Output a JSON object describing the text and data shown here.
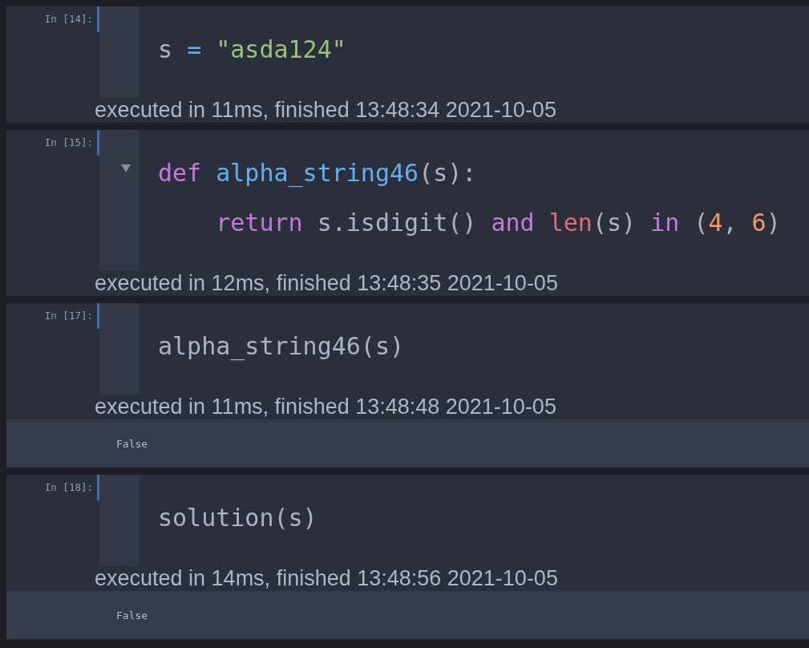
{
  "cells": [
    {
      "prompt": "In [14]:",
      "collapsible": false,
      "lines": [
        [
          {
            "kind": "name",
            "text": "s "
          },
          {
            "kind": "operator",
            "text": "="
          },
          {
            "kind": "string",
            "text": " \"asda124\""
          }
        ]
      ],
      "status": "executed in 11ms, finished 13:48:34 2021-10-05"
    },
    {
      "prompt": "In [15]:",
      "collapsible": true,
      "lines": [
        [
          {
            "kind": "keyword",
            "text": "def "
          },
          {
            "kind": "function",
            "text": "alpha_string46"
          },
          {
            "kind": "name",
            "text": "(s):"
          }
        ],
        [
          {
            "kind": "keyword",
            "text": "    return"
          },
          {
            "kind": "name",
            "text": " s.isdigit() "
          },
          {
            "kind": "keyword",
            "text": "and "
          },
          {
            "kind": "builtin",
            "text": "len"
          },
          {
            "kind": "name",
            "text": "(s) "
          },
          {
            "kind": "keyword",
            "text": "in"
          },
          {
            "kind": "name",
            "text": " ("
          },
          {
            "kind": "number",
            "text": "4"
          },
          {
            "kind": "name",
            "text": ", "
          },
          {
            "kind": "number",
            "text": "6"
          },
          {
            "kind": "name",
            "text": ")"
          }
        ]
      ],
      "status": "executed in 12ms, finished 13:48:35 2021-10-05"
    },
    {
      "prompt": "In [17]:",
      "collapsible": false,
      "lines": [
        [
          {
            "kind": "name",
            "text": "alpha_string46(s)"
          }
        ]
      ],
      "status": "executed in 11ms, finished 13:48:48 2021-10-05",
      "output": "False"
    },
    {
      "prompt": "In [18]:",
      "collapsible": false,
      "lines": [
        [
          {
            "kind": "name",
            "text": "solution(s)"
          }
        ]
      ],
      "status": "executed in 14ms, finished 13:48:56 2021-10-05",
      "output": "False"
    }
  ]
}
